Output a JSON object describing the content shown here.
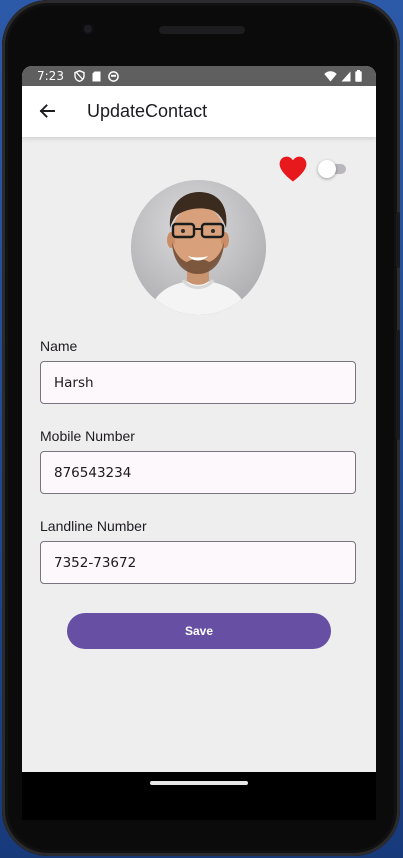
{
  "status_bar": {
    "time": "7:23",
    "left_icons": [
      "shield-icon",
      "sd-card-icon",
      "emoji-icon"
    ],
    "right_icons": [
      "wifi-icon",
      "signal-icon",
      "battery-icon"
    ]
  },
  "app_bar": {
    "back_icon": "arrow-back-icon",
    "title": "UpdateContact"
  },
  "header_actions": {
    "favorite_icon": "heart-icon",
    "favorite_color": "#e8191c",
    "favorite_on": true,
    "switch_on": false
  },
  "avatar": {
    "icon": "contact-photo"
  },
  "form": {
    "name": {
      "label": "Name",
      "value": "Harsh"
    },
    "mobile": {
      "label": "Mobile Number",
      "value": "876543234"
    },
    "landline": {
      "label": "Landline Number",
      "value": "7352-73672"
    }
  },
  "save_button": {
    "label": "Save",
    "color": "#6750a4"
  }
}
